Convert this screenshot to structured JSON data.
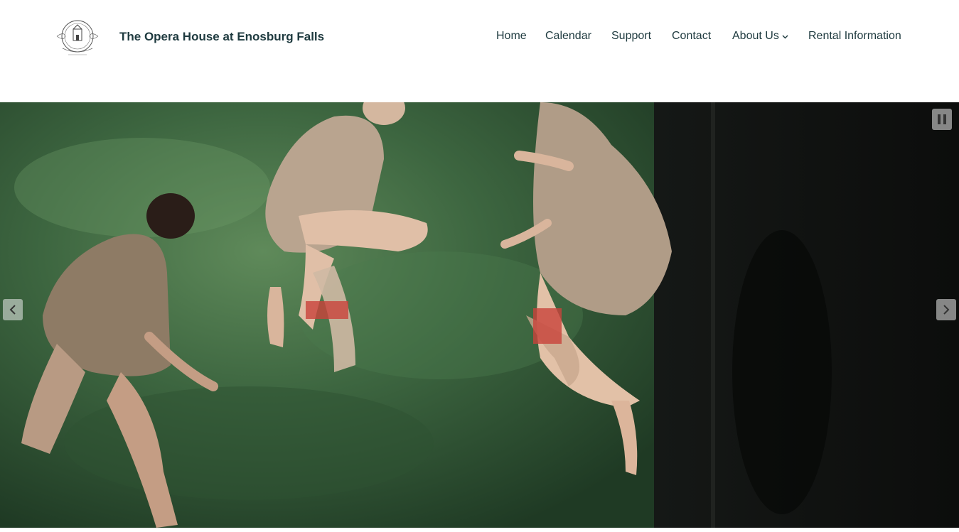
{
  "header": {
    "logo_icon": "opera-house-seal-logo",
    "site_title": "The Opera House at Enosburg Falls"
  },
  "nav": {
    "items": [
      {
        "label": "Home"
      },
      {
        "label": "Calendar"
      },
      {
        "label": "Support"
      },
      {
        "label": "Contact"
      },
      {
        "label": "About Us",
        "has_dropdown": true
      },
      {
        "label": "Rental Information"
      }
    ],
    "dropdown_icon": "chevron-down-icon"
  },
  "slider": {
    "image_subject": "dancers-in-fringed-costumes-photo",
    "controls": {
      "pause_icon": "pause-icon",
      "prev_icon": "chevron-left-icon",
      "next_icon": "chevron-right-icon"
    }
  },
  "colors": {
    "text": "#1e3a3f",
    "background": "#ffffff",
    "control_bg": "#ebebeb"
  }
}
